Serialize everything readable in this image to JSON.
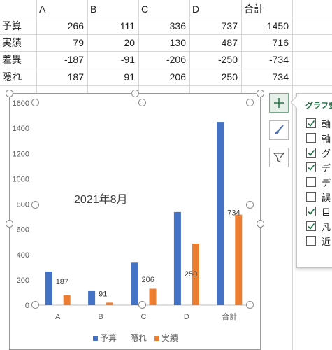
{
  "sheet": {
    "column_headers": [
      "A",
      "B",
      "C",
      "D",
      "合計"
    ],
    "rows": [
      {
        "label": "予算",
        "values": [
          "266",
          "111",
          "336",
          "737",
          "1450"
        ]
      },
      {
        "label": "実績",
        "values": [
          "79",
          "20",
          "130",
          "487",
          "716"
        ]
      },
      {
        "label": "差異",
        "values": [
          "-187",
          "-91",
          "-206",
          "-250",
          "-734"
        ]
      },
      {
        "label": "隠れ",
        "values": [
          "187",
          "91",
          "206",
          "250",
          "734"
        ]
      }
    ]
  },
  "chart_data": {
    "type": "bar",
    "title": "2021年8月",
    "categories": [
      "A",
      "B",
      "C",
      "D",
      "合計"
    ],
    "series": [
      {
        "name": "予算",
        "values": [
          266,
          111,
          336,
          737,
          1450
        ],
        "color": "#4472c4"
      },
      {
        "name": "隠れ",
        "values": [
          187,
          91,
          206,
          250,
          734
        ],
        "color": "none",
        "data_labels": [
          "187",
          "91",
          "206",
          "250",
          "734"
        ]
      },
      {
        "name": "実績",
        "values": [
          79,
          20,
          130,
          487,
          716
        ],
        "color": "#ed7d31"
      }
    ],
    "ylim": [
      0,
      1600
    ],
    "yticks": [
      "0",
      "200",
      "400",
      "600",
      "800",
      "1000",
      "1200",
      "1400",
      "1600"
    ],
    "grid": false,
    "legend": "bottom"
  },
  "chart_buttons": {
    "elements_icon": "plus-icon",
    "styles_icon": "brush-icon",
    "filters_icon": "funnel-icon",
    "accent_color": "#217346"
  },
  "flyout": {
    "title": "グラフ要",
    "items": [
      {
        "label": "軸",
        "checked": true
      },
      {
        "label": "軸",
        "checked": false
      },
      {
        "label": "グ",
        "checked": true
      },
      {
        "label": "デ",
        "checked": true
      },
      {
        "label": "デ",
        "checked": false
      },
      {
        "label": "誤",
        "checked": false
      },
      {
        "label": "目",
        "checked": true
      },
      {
        "label": "凡",
        "checked": true
      },
      {
        "label": "近",
        "checked": false
      }
    ]
  }
}
